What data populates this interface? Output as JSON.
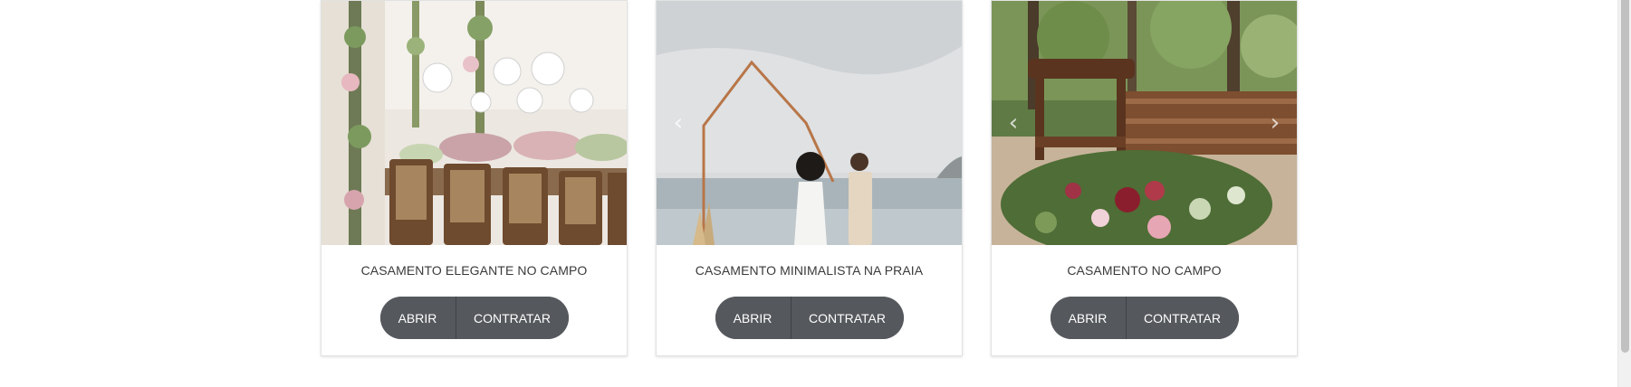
{
  "cards": [
    {
      "title": "CASAMENTO ELEGANTE NO CAMPO",
      "image_subject": "rustic wedding reception table with hanging glass lanterns and floral columns",
      "open_label": "ABRIR",
      "hire_label": "CONTRATAR"
    },
    {
      "title": "CASAMENTO MINIMALISTA NA PRAIA",
      "image_subject": "couple under a copper arch on the beach",
      "open_label": "ABRIR",
      "hire_label": "CONTRATAR"
    },
    {
      "title": "CASAMENTO NO CAMPO",
      "image_subject": "outdoor ceremony with wooden chairs and a large floral arrangement",
      "open_label": "ABRIR",
      "hire_label": "CONTRATAR"
    }
  ],
  "carousel": {
    "prev_icon": "chevron-left-icon",
    "next_icon": "chevron-right-icon"
  },
  "colors": {
    "button_bg": "#55585c",
    "button_text": "#ffffff",
    "title_text": "#3a3a3a",
    "card_border": "#e2e2e2"
  }
}
